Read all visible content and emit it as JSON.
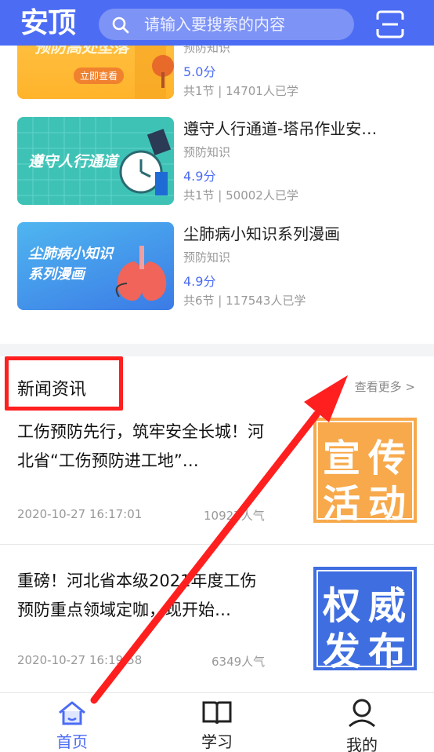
{
  "header": {
    "logo": "安顶",
    "search_placeholder": "请输入要搜索的内容",
    "accent": "#4c6cf4"
  },
  "courses": [
    {
      "thumb_text": "预防高处坠落",
      "thumb_button": "立即查看",
      "title": "",
      "category": "预防知识",
      "score": "5.0分",
      "meta": "共1节 | 14701人已学"
    },
    {
      "thumb_text": "遵守人行通道",
      "title": "遵守人行通道-塔吊作业安…",
      "category": "预防知识",
      "score": "4.9分",
      "meta": "共1节 | 50002人已学"
    },
    {
      "thumb_text_line1": "尘肺病小知识",
      "thumb_text_line2": "系列漫画",
      "title": "尘肺病小知识系列漫画",
      "category": "预防知识",
      "score": "4.9分",
      "meta": "共6节 | 117543人已学"
    }
  ],
  "news": {
    "section_title": "新闻资讯",
    "more_label": "查看更多 >",
    "items": [
      {
        "title": "工伤预防先行，筑牢安全长城！河北省“工伤预防进工地”…",
        "time": "2020-10-27 16:17:01",
        "popularity": "10927人气",
        "image_chars": [
          "宣",
          "传",
          "活",
          "动"
        ]
      },
      {
        "title": "重磅！河北省本级2021年度工伤预防重点领域定咖，现开始…",
        "time": "2020-10-27 16:19:58",
        "popularity": "6349人气",
        "image_chars": [
          "权",
          "威",
          "发",
          "布"
        ]
      }
    ]
  },
  "tabbar": {
    "items": [
      {
        "label": "首页",
        "active": true
      },
      {
        "label": "学习",
        "active": false
      },
      {
        "label": "我的",
        "active": false
      }
    ],
    "active_color": "#4c6cf4",
    "inactive_color": "#222222"
  },
  "annotation": {
    "highlight_color": "#ff1f1f"
  }
}
